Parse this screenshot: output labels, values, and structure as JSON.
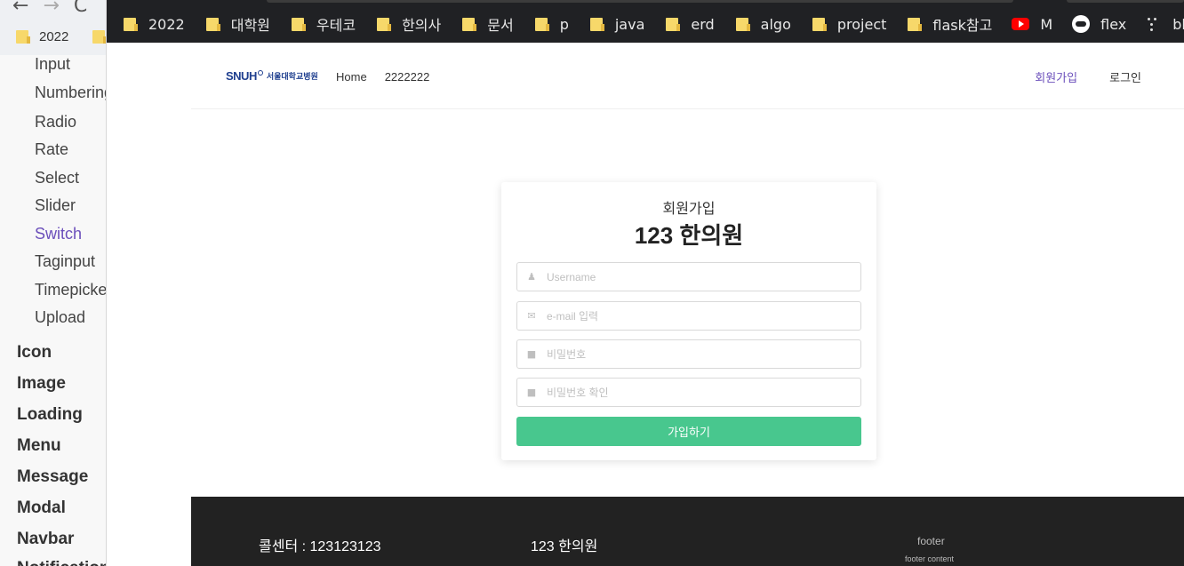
{
  "back_window": {
    "nav_icons": [
      "back-arrow",
      "forward-arrow",
      "reload"
    ],
    "bookmark_label": "2022",
    "sidebar_sub_items": [
      "Input",
      "Numbering",
      "Radio",
      "Rate",
      "Select",
      "Slider",
      "Switch",
      "Taginput",
      "Timepicker",
      "Upload"
    ],
    "sidebar_active": "Switch",
    "sidebar_main_items": [
      "Icon",
      "Image",
      "Loading",
      "Menu",
      "Message",
      "Modal",
      "Navbar",
      "Notification"
    ]
  },
  "bookmarks": [
    {
      "label": "2022",
      "icon": "folder-icon"
    },
    {
      "label": "대학원",
      "icon": "folder-icon"
    },
    {
      "label": "우테코",
      "icon": "folder-icon"
    },
    {
      "label": "한의사",
      "icon": "folder-icon"
    },
    {
      "label": "문서",
      "icon": "folder-icon"
    },
    {
      "label": "p",
      "icon": "folder-icon"
    },
    {
      "label": "java",
      "icon": "folder-icon"
    },
    {
      "label": "erd",
      "icon": "folder-icon"
    },
    {
      "label": "algo",
      "icon": "folder-icon"
    },
    {
      "label": "project",
      "icon": "folder-icon"
    },
    {
      "label": "flask참고",
      "icon": "folder-icon"
    },
    {
      "label": "M",
      "icon": "youtube-icon"
    },
    {
      "label": "flex",
      "icon": "cloud-icon"
    },
    {
      "label": "block vs inli",
      "icon": "dots-icon"
    }
  ],
  "header": {
    "logo_text": "SNUH",
    "logo_kr": "서울대학교병원",
    "nav": [
      "Home",
      "2222222"
    ],
    "signup_label": "회원가입",
    "login_label": "로그인",
    "signup_color": "#6b4fbb"
  },
  "card": {
    "subtitle": "회원가입",
    "title": "123 한의원",
    "username_placeholder": "Username",
    "email_placeholder": "e-mail 입력",
    "password_placeholder": "비밀번호",
    "password_confirm_placeholder": "비밀번호 확인",
    "submit_label": "가입하기",
    "submit_color": "#48c78e"
  },
  "footer": {
    "call_center": "콜센터 : 123123123",
    "clinic_name": "123 한의원",
    "footer_title": "footer",
    "footer_content": "footer content"
  }
}
